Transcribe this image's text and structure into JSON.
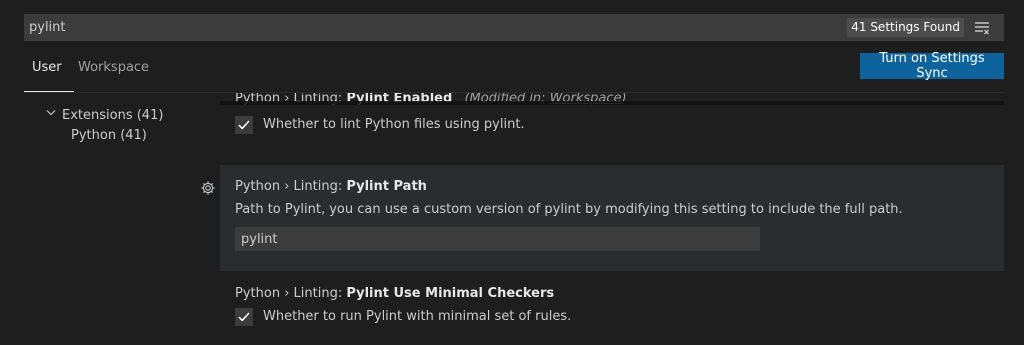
{
  "search": {
    "value": "pylint",
    "results_label": "41 Settings Found"
  },
  "tabs": [
    {
      "label": "User"
    },
    {
      "label": "Workspace"
    }
  ],
  "sync_button": {
    "label": "Turn on Settings Sync"
  },
  "toc": {
    "extensions_label": "Extensions (41)",
    "python_label": "Python (41)"
  },
  "settings": [
    {
      "category": "Python › Linting: ",
      "name": "Pylint Enabled",
      "modified_prefix": "(Modified in: ",
      "modified_scope": "Workspace",
      "modified_suffix": ")",
      "description": "Whether to lint Python files using pylint.",
      "checked": true
    },
    {
      "category": "Python › Linting: ",
      "name": "Pylint Path",
      "description": "Path to Pylint, you can use a custom version of pylint by modifying this setting to include the full path.",
      "value": "pylint"
    },
    {
      "category": "Python › Linting: ",
      "name": "Pylint Use Minimal Checkers",
      "description": "Whether to run Pylint with minimal set of rules.",
      "checked": true
    }
  ]
}
